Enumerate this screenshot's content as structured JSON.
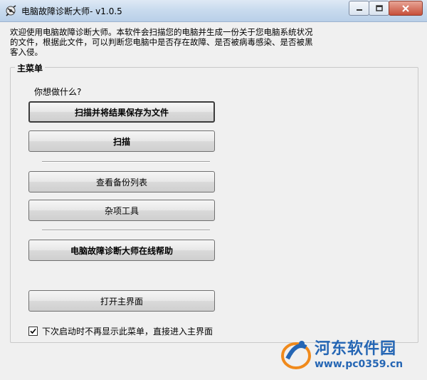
{
  "window": {
    "title": "电脑故障诊断大师- v1.0.5",
    "app_icon": "app-icon",
    "controls": [
      "minimize-icon",
      "maximize-icon",
      "close-icon"
    ]
  },
  "intro_text": "欢迎使用电脑故障诊断大师。本软件会扫描您的电脑并生成一份关于您电脑系统状况的文件，根据此文件，可以判断您电脑中是否存在故障、是否被病毒感染、是否被黑客入侵。",
  "main_menu": {
    "label": "主菜单",
    "question": "你想做什么?",
    "buttons": {
      "scan_save": "扫描并将结果保存为文件",
      "scan": "扫描",
      "view_backup": "查看备份列表",
      "misc_tools": "杂项工具",
      "online_help": "电脑故障诊断大师在线帮助",
      "open_main": "打开主界面"
    },
    "checkbox": {
      "label": "下次启动时不再显示此菜单，直接进入主界面",
      "checked": true
    }
  },
  "watermark": {
    "name": "河东软件园",
    "url": "www.pc0359.cn"
  },
  "colors": {
    "accent": "#2566b4",
    "background": "#f0f0f0"
  }
}
